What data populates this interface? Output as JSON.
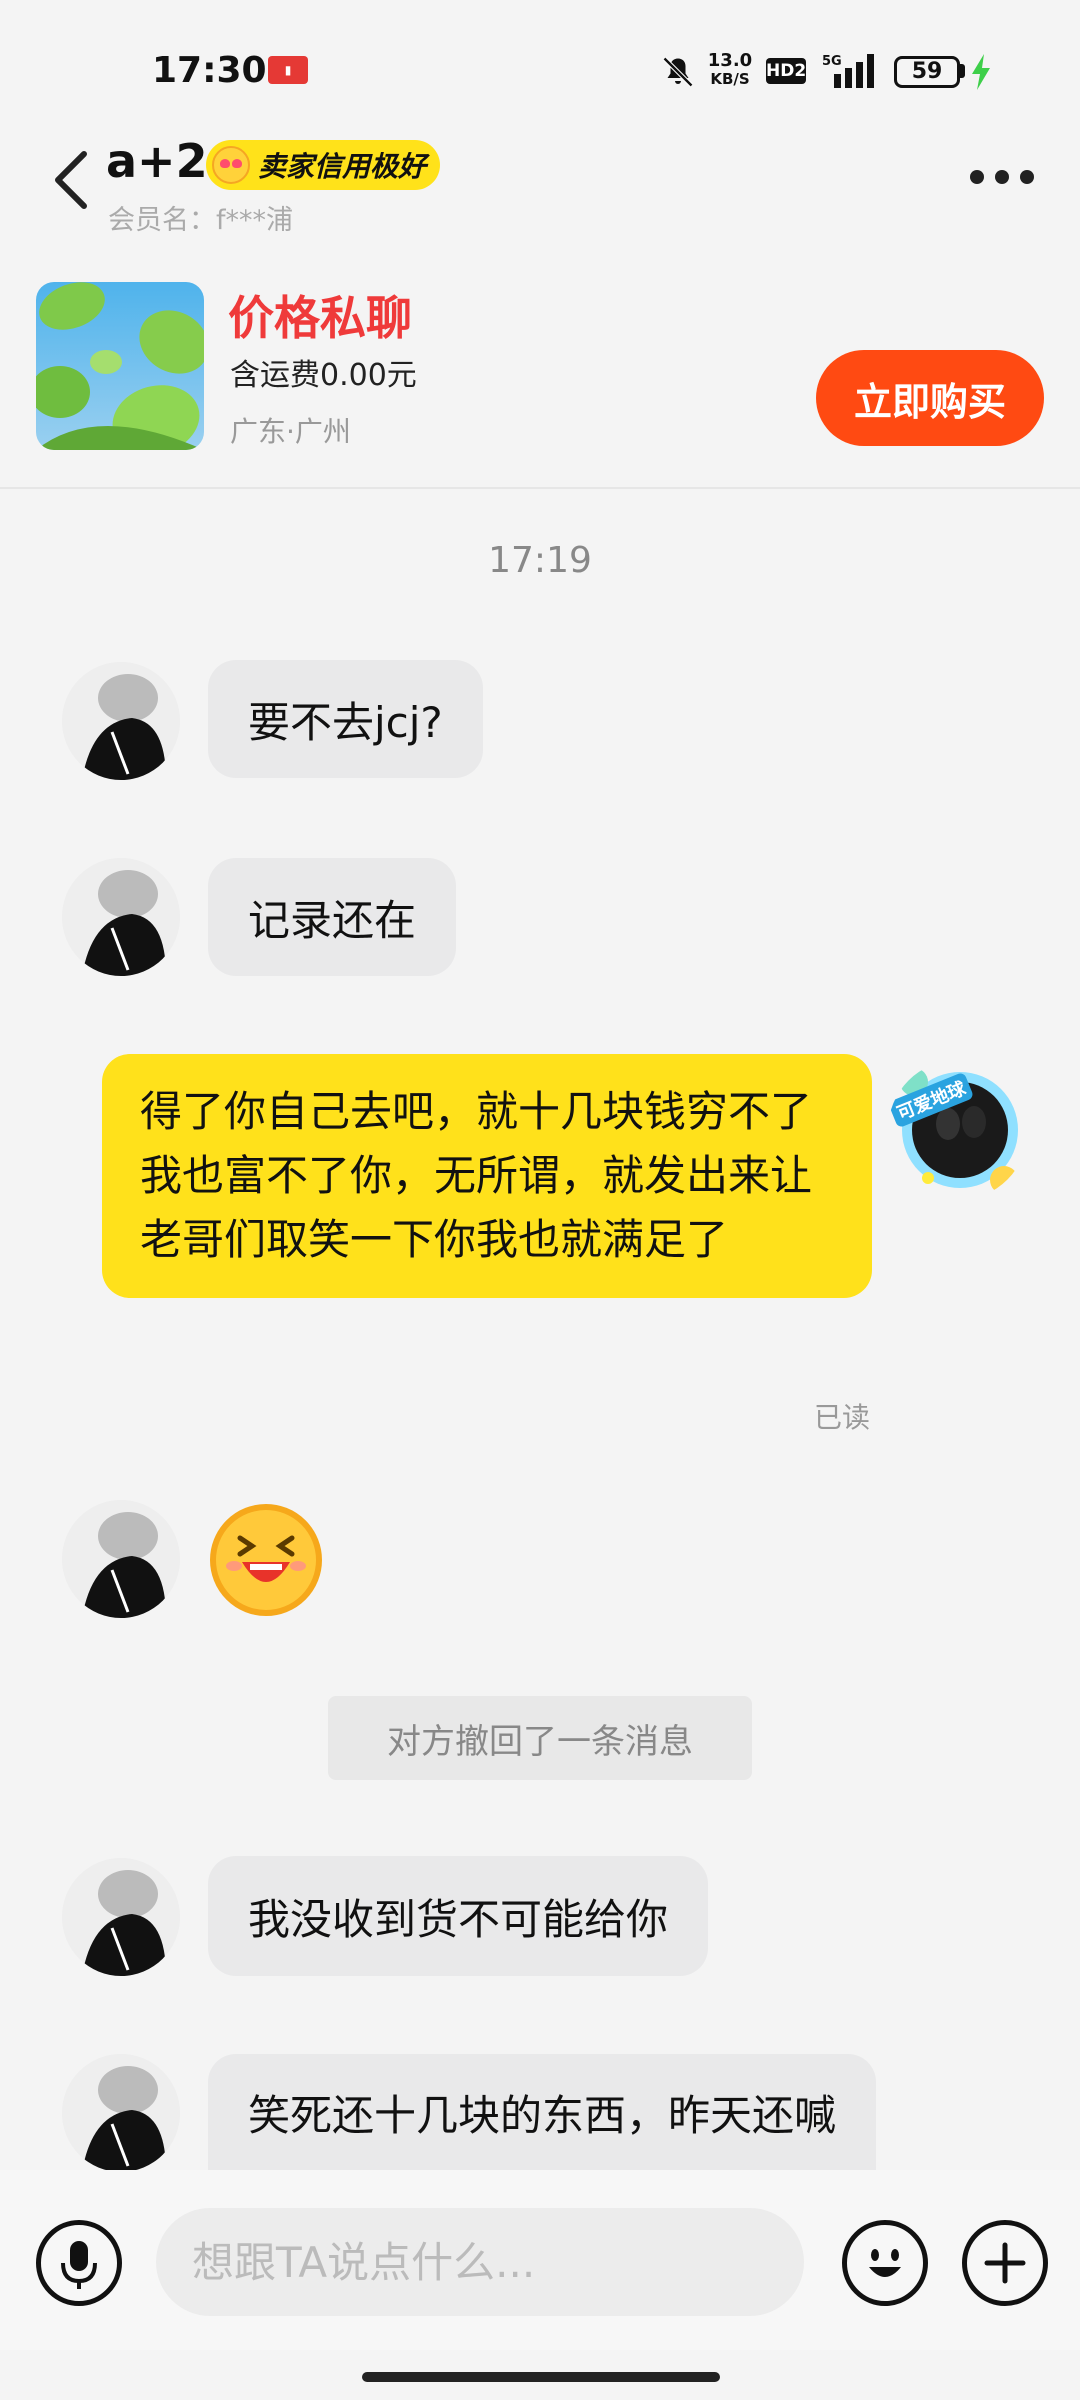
{
  "status_bar": {
    "time": "17:30",
    "net_speed_value": "13.0",
    "net_speed_unit": "KB/S",
    "hd_label": "HD2",
    "network_type": "5G",
    "battery_level": "59"
  },
  "header": {
    "user_name": "a+2",
    "credit_badge": "卖家信用极好",
    "member_name": "会员名：f***浦"
  },
  "product": {
    "price_label": "价格私聊",
    "shipping": "含运费0.00元",
    "location": "广东·广州",
    "buy_button": "立即购买"
  },
  "chat": {
    "timestamp": "17:19",
    "messages": [
      {
        "from": "other",
        "text": "要不去jcj?"
      },
      {
        "from": "other",
        "text": "记录还在"
      },
      {
        "from": "me",
        "text": "得了你自己去吧，就十几块钱穷不了我也富不了你，无所谓，就发出来让老哥们取笑一下你我也就满足了"
      },
      {
        "from": "other",
        "text": ""
      },
      {
        "from": "other",
        "text": "我没收到货不可能给你"
      },
      {
        "from": "other",
        "text": "笑死还十几块的东西，昨天还喊"
      }
    ],
    "read_status": "已读",
    "recall_notice": "对方撤回了一条消息",
    "my_avatar_sticker": "可爱地球"
  },
  "input_bar": {
    "placeholder": "想跟TA说点什么..."
  },
  "colors": {
    "accent_red": "#ef3a3a",
    "buy_orange": "#ff4a12",
    "my_bubble": "#ffe11b",
    "their_bubble": "#e9e9ea"
  }
}
